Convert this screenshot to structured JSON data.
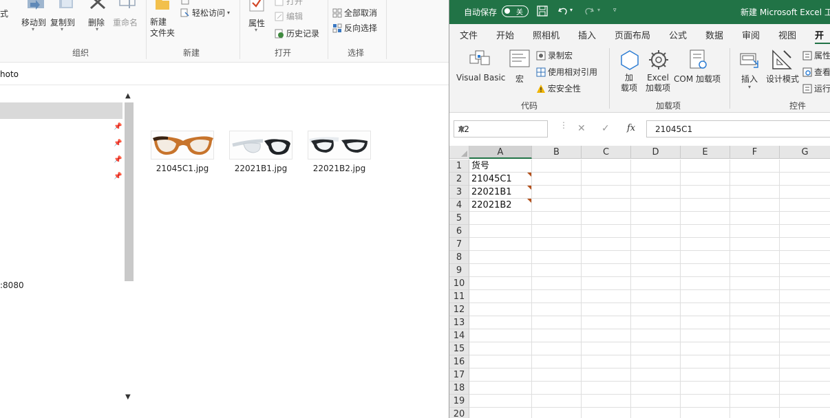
{
  "explorer": {
    "ribbon": {
      "left_cut_label": "式",
      "move_to": "移动到",
      "copy_to": "复制到",
      "delete": "删除",
      "rename": "重命名",
      "new_folder": "新建\n文件夹",
      "easy_access": "轻松访问",
      "properties": "属性",
      "open": "打开",
      "edit": "编辑",
      "history": "历史记录",
      "select_none": "全部取消",
      "invert_selection": "反向选择",
      "groups": {
        "organize": "组织",
        "new": "新建",
        "open": "打开",
        "select": "选择"
      }
    },
    "address_text": "hoto",
    "nav_text_8080": ":8080",
    "files": [
      {
        "name": "21045C1.jpg"
      },
      {
        "name": "22021B1.jpg"
      },
      {
        "name": "22021B2.jpg"
      }
    ]
  },
  "excel": {
    "autosave_label": "自动保存",
    "autosave_state": "关",
    "title": "新建 Microsoft Excel 工",
    "tabs": [
      "文件",
      "开始",
      "照相机",
      "插入",
      "页面布局",
      "公式",
      "数据",
      "审阅",
      "视图",
      "开发"
    ],
    "active_tab": "开发",
    "ribbon": {
      "visual_basic": "Visual Basic",
      "macros": "宏",
      "record_macro": "录制宏",
      "relative_ref": "使用相对引用",
      "macro_security": "宏安全性",
      "addins": "加\n载项",
      "excel_addins": "Excel\n加载项",
      "com_addins": "COM 加载项",
      "insert": "插入",
      "design_mode": "设计模式",
      "properties": "属性",
      "view_code": "查看",
      "run_dialog": "运行",
      "groups": {
        "code": "代码",
        "addins": "加载项",
        "controls": "控件"
      }
    },
    "name_box": "A2",
    "formula": "21045C1",
    "columns": [
      "A",
      "B",
      "C",
      "D",
      "E",
      "F",
      "G"
    ],
    "rows": [
      "1",
      "2",
      "3",
      "4",
      "5",
      "6",
      "7",
      "8",
      "9",
      "10",
      "11",
      "12",
      "13",
      "14",
      "15",
      "16",
      "17",
      "18",
      "19",
      "20"
    ],
    "cells_a": [
      "货号",
      "21045C1",
      "22021B1",
      "22021B2"
    ],
    "accent": "#217346"
  }
}
